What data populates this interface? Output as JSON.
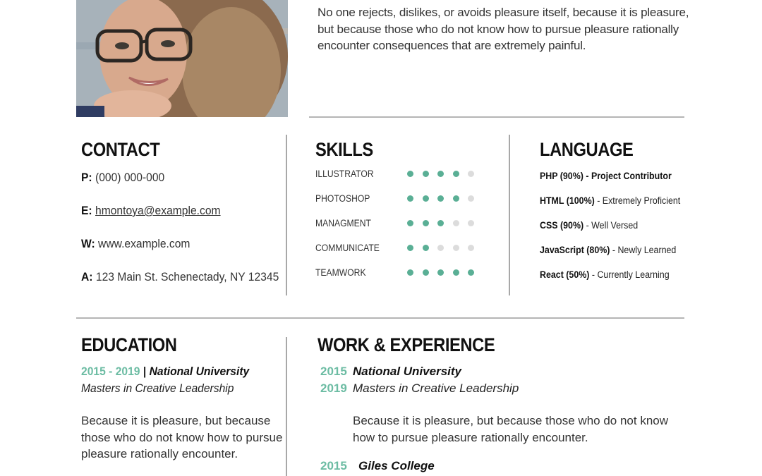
{
  "profile": {
    "photo_alt": "portrait-photo",
    "intro": "No one rejects, dislikes, or avoids pleasure itself, because it is pleasure, but because those who do not know how to pursue pleasure rationally encounter consequences that are extremely painful."
  },
  "colors": {
    "accent": "#6cbca3",
    "dot_on": "#5aaf95",
    "dot_off": "#dcdcdc",
    "divider": "#b5b5b5"
  },
  "contact": {
    "title": "CONTACT",
    "items": [
      {
        "label": "P:",
        "value": "(000) 000-000"
      },
      {
        "label": "E:",
        "value": "hmontoya@example.com"
      },
      {
        "label": "W:",
        "value": "www.example.com"
      },
      {
        "label": "A:",
        "value": "123 Main St. Schenectady, NY 12345"
      }
    ]
  },
  "skills": {
    "title": "SKILLS",
    "max": 5,
    "items": [
      {
        "name": "ILLUSTRATOR",
        "level": 4
      },
      {
        "name": "PHOTOSHOP",
        "level": 4
      },
      {
        "name": "MANAGMENT",
        "level": 3
      },
      {
        "name": "COMMUNICATE",
        "level": 2
      },
      {
        "name": "TEAMWORK",
        "level": 5
      }
    ]
  },
  "language": {
    "title": "LANGUAGE",
    "items": [
      {
        "name": "PHP (90%)",
        "desc": "Project Contributor",
        "desc_bold": true
      },
      {
        "name": "HTML (100%)",
        "desc": "Extremely Proficient",
        "desc_bold": false
      },
      {
        "name": "CSS (90%)",
        "desc": "Well Versed",
        "desc_bold": false
      },
      {
        "name": "JavaScript (80%)",
        "desc": "Newly Learned",
        "desc_bold": false
      },
      {
        "name": "React (50%)",
        "desc": "Currently Learning",
        "desc_bold": false
      }
    ]
  },
  "education": {
    "title": "EDUCATION",
    "years": "2015 - 2019",
    "separator": "|",
    "school": "National University",
    "degree": "Masters in Creative Leadership",
    "description": "Because it is pleasure, but because those who do not know how to pursue pleasure rationally encounter."
  },
  "work": {
    "title": "WORK & EXPERIENCE",
    "items": [
      {
        "start": "2015",
        "end": "2019",
        "org": "National University",
        "role": "Masters in Creative Leadership",
        "description": "Because it is pleasure, but because those who do not know how to pursue pleasure rationally encounter."
      },
      {
        "start": "2015",
        "org": "Giles College"
      }
    ]
  }
}
